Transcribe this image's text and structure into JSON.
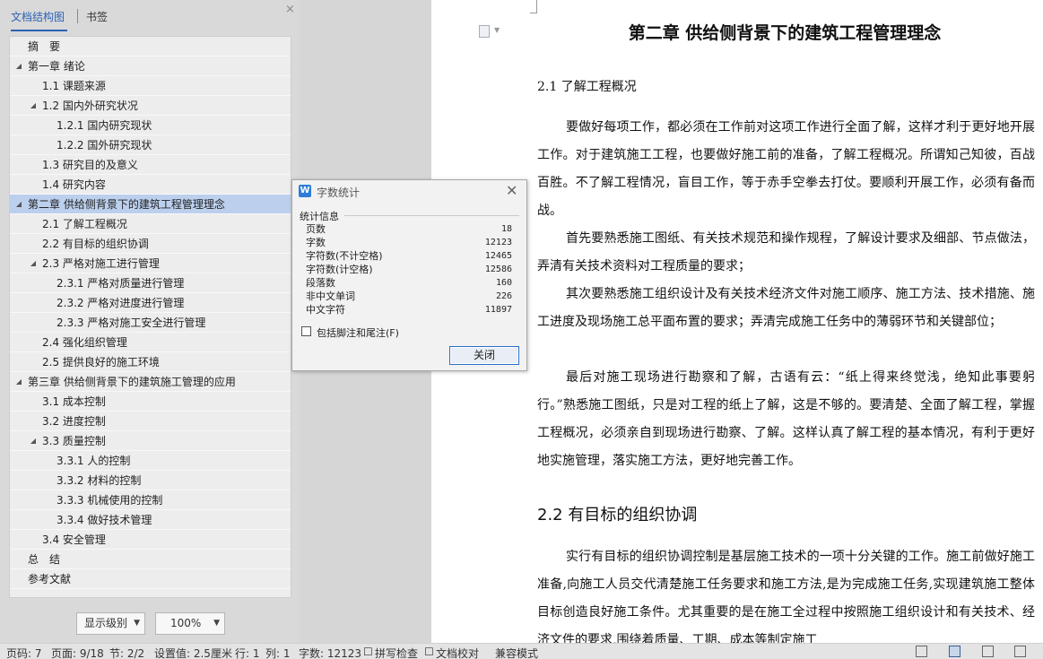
{
  "nav": {
    "tabs": [
      {
        "label": "文档结构图",
        "active": true
      },
      {
        "label": "书签",
        "active": false
      }
    ],
    "close": "×",
    "tree": [
      {
        "label": "摘　要",
        "level": 0,
        "arrow": false
      },
      {
        "label": "第一章  绪论",
        "level": 0,
        "arrow": true
      },
      {
        "label": "1.1  课题来源",
        "level": 1,
        "arrow": false
      },
      {
        "label": "1.2  国内外研究状况",
        "level": 1,
        "arrow": true
      },
      {
        "label": "1.2.1 国内研究现状",
        "level": 2,
        "arrow": false
      },
      {
        "label": "1.2.2 国外研究现状",
        "level": 2,
        "arrow": false
      },
      {
        "label": "1.3  研究目的及意义",
        "level": 1,
        "arrow": false
      },
      {
        "label": "1.4  研究内容",
        "level": 1,
        "arrow": false
      },
      {
        "label": "第二章  供给侧背景下的建筑工程管理理念",
        "level": 0,
        "arrow": true,
        "selected": true
      },
      {
        "label": "2.1 了解工程概况",
        "level": 1,
        "arrow": false
      },
      {
        "label": "2.2 有目标的组织协调",
        "level": 1,
        "arrow": false
      },
      {
        "label": "2.3 严格对施工进行管理",
        "level": 1,
        "arrow": true
      },
      {
        "label": "2.3.1 严格对质量进行管理",
        "level": 2,
        "arrow": false
      },
      {
        "label": "2.3.2 严格对进度进行管理",
        "level": 2,
        "arrow": false
      },
      {
        "label": "2.3.3 严格对施工安全进行管理",
        "level": 2,
        "arrow": false
      },
      {
        "label": "2.4 强化组织管理",
        "level": 1,
        "arrow": false
      },
      {
        "label": "2.5 提供良好的施工环境",
        "level": 1,
        "arrow": false
      },
      {
        "label": "第三章  供给侧背景下的建筑施工管理的应用",
        "level": 0,
        "arrow": true
      },
      {
        "label": "3.1 成本控制",
        "level": 1,
        "arrow": false
      },
      {
        "label": "3.2 进度控制",
        "level": 1,
        "arrow": false
      },
      {
        "label": "3.3 质量控制",
        "level": 1,
        "arrow": true
      },
      {
        "label": "3.3.1 人的控制",
        "level": 2,
        "arrow": false
      },
      {
        "label": "3.3.2 材料的控制",
        "level": 2,
        "arrow": false
      },
      {
        "label": "3.3.3 机械使用的控制",
        "level": 2,
        "arrow": false
      },
      {
        "label": "3.3.4  做好技术管理",
        "level": 2,
        "arrow": false
      },
      {
        "label": "3.4 安全管理",
        "level": 1,
        "arrow": false
      },
      {
        "label": "总　结",
        "level": 0,
        "arrow": false
      },
      {
        "label": "参考文献",
        "level": 0,
        "arrow": false
      }
    ],
    "display_level": "显示级别",
    "zoom": "100%"
  },
  "dialog": {
    "title": "字数统计",
    "group_label": "统计信息",
    "stats": [
      {
        "label": "页数",
        "value": "18"
      },
      {
        "label": "字数",
        "value": "12123"
      },
      {
        "label": "字符数(不计空格)",
        "value": "12465"
      },
      {
        "label": "字符数(计空格)",
        "value": "12586"
      },
      {
        "label": "段落数",
        "value": "160"
      },
      {
        "label": "非中文单词",
        "value": "226"
      },
      {
        "label": "中文字符",
        "value": "11897"
      }
    ],
    "checkbox_label": "包括脚注和尾注(F)",
    "close_button": "关闭"
  },
  "doc": {
    "chapter_title": "第二章  供给侧背景下的建筑工程管理理念",
    "section_21": "2.1 了解工程概况",
    "p1": "要做好每项工作，都必须在工作前对这项工作进行全面了解，这样才利于更好地开展工作。对于建筑施工工程，也要做好施工前的准备，了解工程概况。所谓知己知彼，百战百胜。不了解工程情况，盲目工作，等于赤手空拳去打仗。要顺利开展工作，必须有备而战。",
    "p2": "首先要熟悉施工图纸、有关技术规范和操作规程，了解设计要求及细部、节点做法，弄清有关技术资料对工程质量的要求；",
    "p3": "其次要熟悉施工组织设计及有关技术经济文件对施工顺序、施工方法、技术措施、施工进度及现场施工总平面布置的要求；弄清完成施工任务中的薄弱环节和关键部位；",
    "p4": "最后对施工现场进行勘察和了解，古语有云：“纸上得来终觉浅，绝知此事要躬行。”熟悉施工图纸，只是对工程的纸上了解，这是不够的。要清楚、全面了解工程，掌握工程概况，必须亲自到现场进行勘察、了解。这样认真了解工程的基本情况，有利于更好地实施管理，落实施工方法，更好地完善工作。",
    "section_22": "2.2 有目标的组织协调",
    "p5": "实行有目标的组织协调控制是基层施工技术的一项十分关键的工作。施工前做好施工准备,向施工人员交代清楚施工任务要求和施工方法,是为完成施工任务,实现建筑施工整体目标创造良好施工条件。尤其重要的是在施工全过程中按照施工组织设计和有关技术、经济文件的要求,围绕着质量、工期、成本等制定施工"
  },
  "status": {
    "page_code": "页码: 7",
    "page": "页面: 9/18",
    "section": "节: 2/2",
    "setting": "设置值: 2.5厘米",
    "row": "行: 1",
    "col": "列: 1",
    "words": "字数: 12123",
    "spell": "拼写检查",
    "proof": "文档校对",
    "compat": "兼容模式"
  }
}
